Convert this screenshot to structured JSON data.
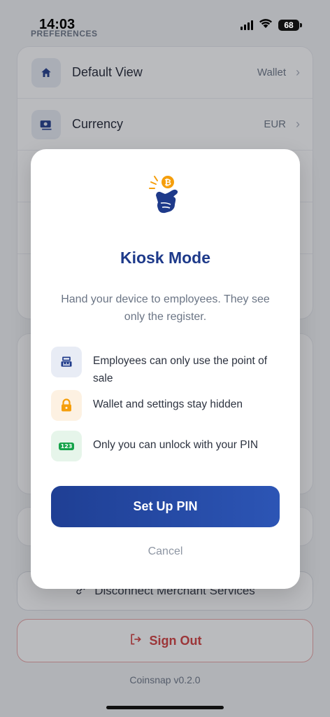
{
  "status_bar": {
    "time": "14:03",
    "battery": "68"
  },
  "preferences": {
    "section_label": "PREFERENCES",
    "rows": [
      {
        "label": "Default View",
        "value": "Wallet",
        "icon": "home-icon"
      },
      {
        "label": "Currency",
        "value": "EUR",
        "icon": "banknote-icon"
      }
    ]
  },
  "actions": {
    "disconnect_label": "Disconnect Merchant Services",
    "signout_label": "Sign Out"
  },
  "version": "Coinsnap v0.2.0",
  "modal": {
    "title": "Kiosk Mode",
    "description": "Hand your device to employees. They see only the register.",
    "features": [
      {
        "text": "Employees can only use the point of sale",
        "icon": "cash-register-icon",
        "bg": "#e8ecf5"
      },
      {
        "text": "Wallet and settings stay hidden",
        "icon": "lock-icon",
        "bg": "#fdf1e2"
      },
      {
        "text": "Only you can unlock with your PIN",
        "icon": "pin-pad-icon",
        "bg": "#e6f5ea",
        "badge": "123"
      }
    ],
    "primary_button": "Set Up PIN",
    "cancel": "Cancel"
  },
  "colors": {
    "brand": "#1e3a8a",
    "accent_orange": "#f59e0b",
    "danger": "#d33b3b",
    "success": "#16a34a"
  }
}
